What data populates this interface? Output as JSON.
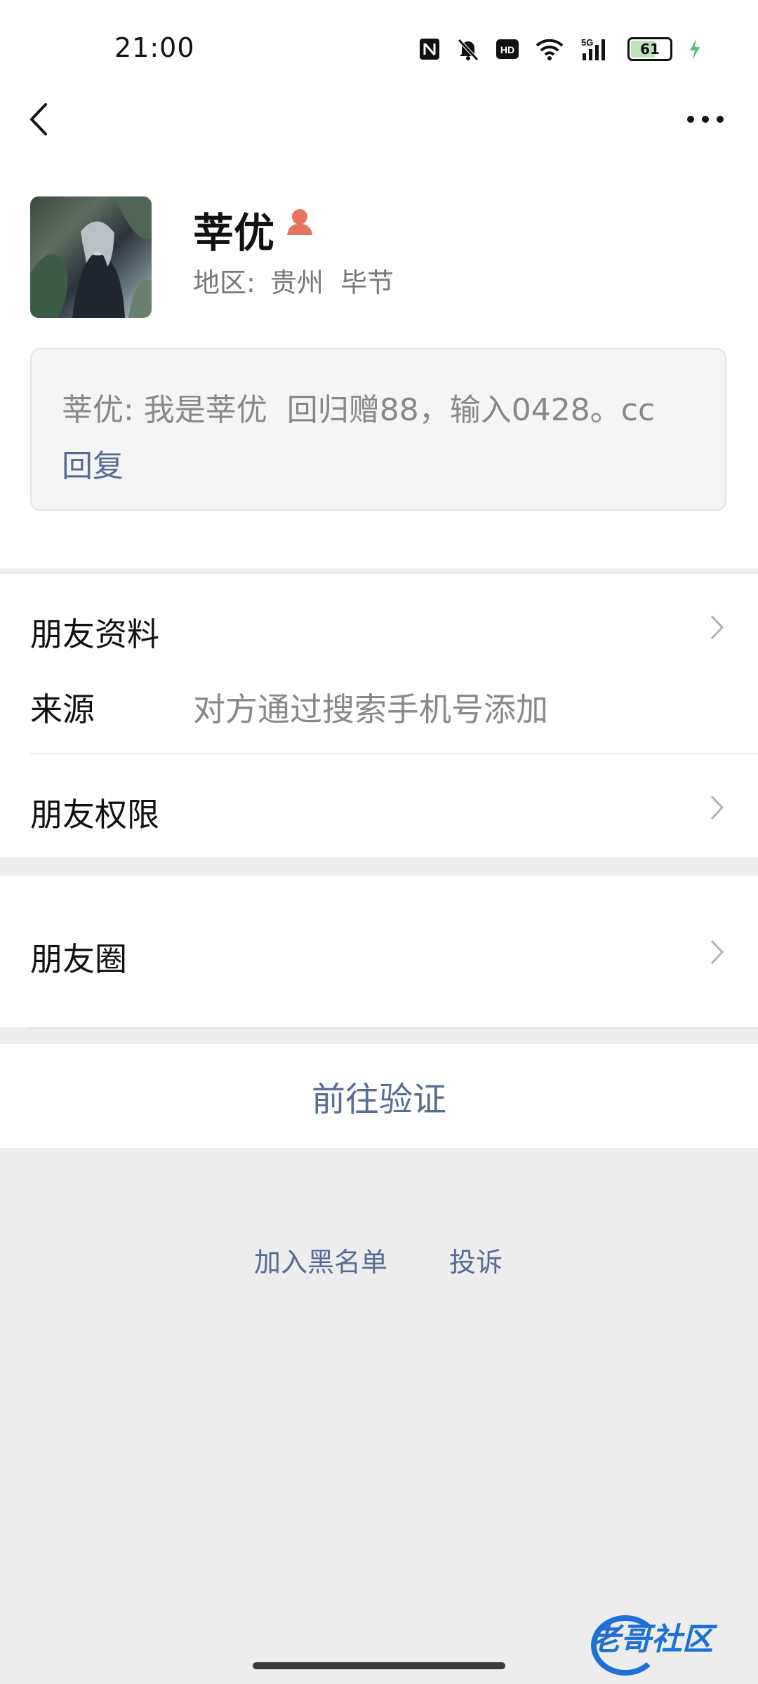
{
  "status_bar": {
    "time": "21:00",
    "battery": "61",
    "icons": [
      "nfc-icon",
      "mute-icon",
      "hd-icon",
      "wifi-icon",
      "5g-signal-icon",
      "battery-icon",
      "charging-icon"
    ]
  },
  "profile": {
    "name": "莘优",
    "region_label": "地区:",
    "region_value": "贵州  毕节",
    "gender": "female"
  },
  "message": {
    "text": "莘优: 我是莘优  回归赠88，输入0428。cc",
    "reply_label": "回复"
  },
  "rows": {
    "friend_profile": "朋友资料",
    "source_label": "来源",
    "source_value": "对方通过搜索手机号添加",
    "friend_permissions": "朋友权限",
    "moments": "朋友圈"
  },
  "actions": {
    "verify": "前往验证",
    "blacklist": "加入黑名单",
    "report": "投诉"
  },
  "watermark": "老哥社区",
  "colors": {
    "link": "#576b95",
    "gender_icon": "#e8735f",
    "background": "#ededed"
  }
}
